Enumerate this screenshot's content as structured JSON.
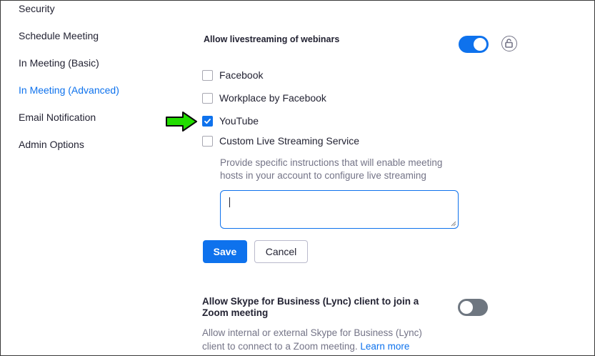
{
  "sidebar": {
    "items": [
      {
        "label": "Security",
        "active": false
      },
      {
        "label": "Schedule Meeting",
        "active": false
      },
      {
        "label": "In Meeting (Basic)",
        "active": false
      },
      {
        "label": "In Meeting (Advanced)",
        "active": true
      },
      {
        "label": "Email Notification",
        "active": false
      },
      {
        "label": "Admin Options",
        "active": false
      }
    ]
  },
  "livestream": {
    "title": "Allow livestreaming of webinars",
    "toggle_on": true,
    "options": [
      {
        "label": "Facebook",
        "checked": false
      },
      {
        "label": "Workplace by Facebook",
        "checked": false
      },
      {
        "label": "YouTube",
        "checked": true
      },
      {
        "label": "Custom Live Streaming Service",
        "checked": false
      }
    ],
    "help_text": "Provide specific instructions that will enable meeting hosts in your account to configure live streaming",
    "textarea_value": "",
    "save_label": "Save",
    "cancel_label": "Cancel"
  },
  "skype": {
    "title": "Allow Skype for Business (Lync) client to join a Zoom meeting",
    "toggle_on": false,
    "description": "Allow internal or external Skype for Business (Lync) client to connect to a Zoom meeting.",
    "link_label": "Learn more"
  },
  "colors": {
    "accent": "#0e72ed",
    "annotation_arrow": "#22dd00",
    "toggle_off": "#6e7680"
  }
}
